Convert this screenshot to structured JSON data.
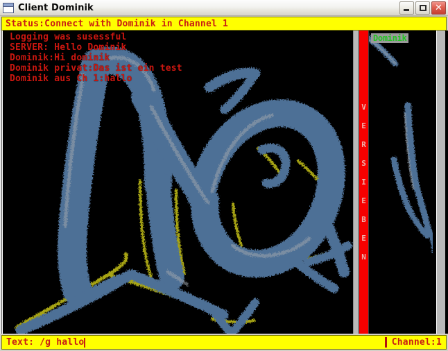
{
  "window": {
    "title": "Client Dominik",
    "icon": "window-icon",
    "buttons": {
      "minimize": "minimize-button",
      "maximize": "maximize-button",
      "close": "close-button",
      "close_glyph": "✕"
    }
  },
  "status": {
    "text": "Status:Connect with Dominik in Channel 1"
  },
  "chat": {
    "lines": [
      "Logging was susessful",
      "SERVER: Hello Dominik",
      "Dominik:Hi dominik",
      "Dominik privat:Das ist ein test",
      "Dominik aus Ch 1:hallo"
    ]
  },
  "divider": {
    "vertical_label": "VERSIEBEN",
    "letters": [
      "V",
      "E",
      "R",
      "S",
      "I",
      "E",
      "B",
      "E",
      "N"
    ]
  },
  "userlist": {
    "users": [
      "Dominik"
    ]
  },
  "input": {
    "text": "Text: /g hallo",
    "placeholder": "Text: ",
    "channel": "Channel:1"
  },
  "colors": {
    "status_bg": "#ffff00",
    "status_fg": "#c81e14",
    "chat_fg": "#cc1710",
    "divider_red": "#f60000",
    "user_green": "#22c422",
    "user_highlight_bg": "#9a9a9a",
    "canvas_bg": "#000000",
    "frame_gray": "#b9b9b9",
    "draw_blue": "#4e6f96",
    "draw_yellow": "#b0ad16"
  }
}
